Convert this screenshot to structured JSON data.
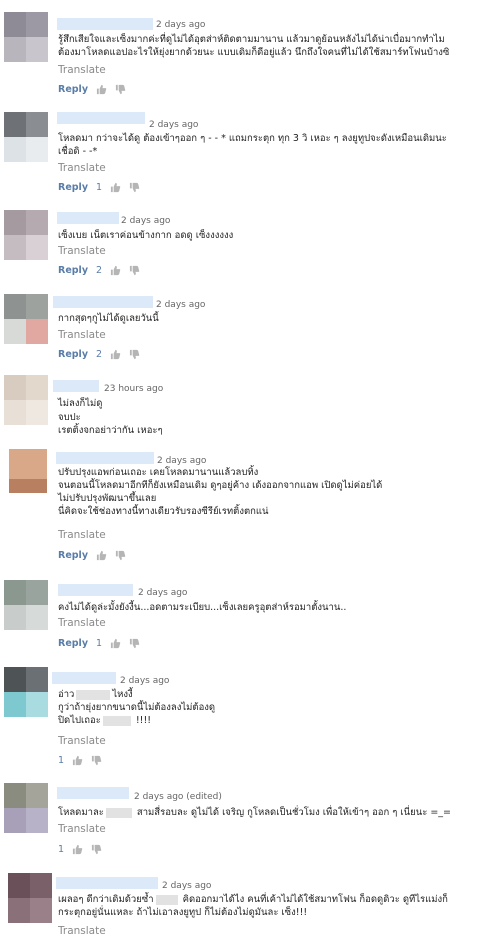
{
  "labels": {
    "reply": "Reply",
    "translate": "Translate"
  },
  "comments": [
    {
      "time": "2 days ago",
      "lines": [
        "รู้สึกเสียใจและเซ็งมากค่ะที่ดูไม่ได้อุตส่าห์ติดตามมานาน แล้วมาดูย้อนหลังไม่ได้น่าเบื่อมากทำไม",
        "ต้องมาโหลดแอปอะไรให้ยุ่งยากด้วยนะ แบบเดิมก็ดีอยู่แล้ว นึกถึงใจคนที่ไม่ได้ใช้สมาร์ทโฟนบ้างซิ"
      ],
      "likes": ""
    },
    {
      "time": "2 days ago",
      "lines": [
        "โหลดมา กว่าจะได้ดู ต้องเข้าๆออก ๆ - - * แถมกระตุก ทุก 3 วิ เหอะ ๆ ลงยูทูปจะดังเหมือนเดิมนะ",
        "เชื่อดิ - -*"
      ],
      "likes": "1"
    },
    {
      "time": "2 days ago",
      "lines": [
        "เซ็งเบย เน็ตเราค่อนข้างกาก อดดู เซ็งงงงงง"
      ],
      "likes": "2"
    },
    {
      "time": "2 days ago",
      "lines": [
        "กากสุดๆกูไม่ได้ดูเลยวันนี้"
      ],
      "likes": "2"
    },
    {
      "time": "23 hours ago",
      "lines": [
        "ไม่ลงก็ไม่ดู",
        "จบปะ",
        "เรตติ้งจกอย่าว่ากัน เหอะๆ"
      ],
      "likes": ""
    },
    {
      "time": "2 days ago",
      "lines": [
        "ปรับปรุงแอพก่อนเถอะ เคยโหลดมานานแล้วลบทิ้ง",
        "จนตอนนี้โหลดมาอีกทีก็ยังเหมือนเดิม ดูๆอยู่ค้าง เด้งออกจากแอพ เปิดดูไม่ค่อยได้",
        "ไม่ปรับปรุงพัฒนาขึ้นเลย",
        "นี่คิดจะใช้ช่องทางนี้ทางเดียวรับรองซีรีย์เรทติ้งตกแน่"
      ],
      "likes": ""
    },
    {
      "time": "2 days ago",
      "lines": [
        "คงไม่ได้ดูล่ะมั้งยังงี้น...อดตามระเบียบ...เซ็งเลยครูอุตส่าห์รอมาตั้งนาน.."
      ],
      "likes": "1"
    },
    {
      "time": "2 days ago",
      "lines": [
        "อ่าว|ไหงงี้",
        "กูว่าถ้ายุ่งยากขนาดนี้ไม่ต้องลงไม่ต้องดู",
        "ปิดไปเถอะ| !!!!"
      ],
      "likes": "1"
    },
    {
      "time": "2 days ago (edited)",
      "lines": [
        "โหลดมาละ| สามสี่รอบละ ดูไม่ได้ เจริญ กูโหลดเป็นชั่วโมง เพื่อให้เข้าๆ ออก ๆ เนี่ยนะ =_="
      ],
      "likes": "1"
    },
    {
      "time": "2 days ago",
      "lines": [
        "เผลอๆ ดีกว่าเดิมด้วยซ้ำ| คิดออกมาได้ไง คนที่เค้าไม่ได้ใช้สมาทโฟน ก็อดดูดิวะ ดูทีไรแม่งก็",
        "กระตุกอยู่นั่นแหละ ถ้าไม่เอาลงยูทูป ก็ไม่ต้องไม่ดูมันละ เซ็ง!!!"
      ],
      "likes": ""
    }
  ]
}
